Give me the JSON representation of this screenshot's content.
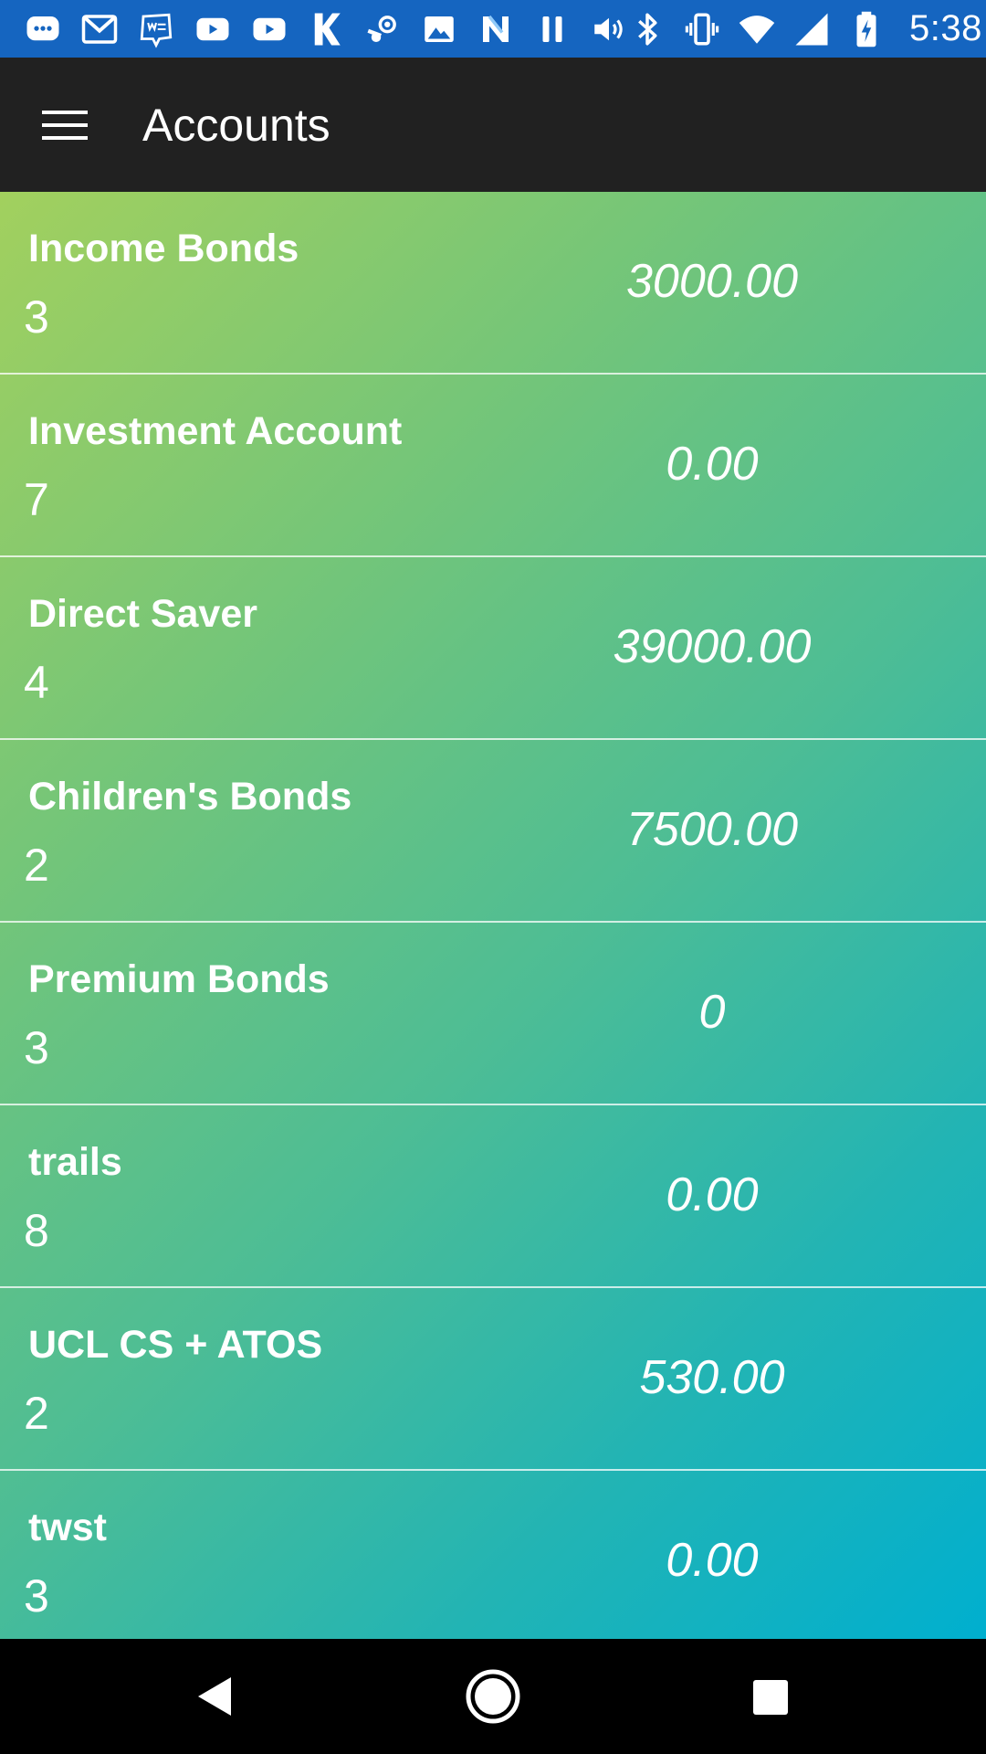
{
  "status_bar": {
    "time": "5:38",
    "bg_color": "#1565c0",
    "left_icons": [
      "message-icon",
      "gmail-icon",
      "webtoon-icon",
      "youtube-icon",
      "youtube-icon",
      "k-app-icon",
      "steam-icon",
      "image-icon",
      "n-app-icon",
      "pause-icon",
      "volume-icon"
    ],
    "right_icons": [
      "bluetooth-icon",
      "vibrate-icon",
      "wifi-icon",
      "signal-icon",
      "battery-charging-icon"
    ]
  },
  "toolbar": {
    "title": "Accounts",
    "menu_icon": "hamburger-menu-icon",
    "bg_color": "#212121"
  },
  "accounts": [
    {
      "name": "Income Bonds",
      "count": "3",
      "balance": "3000.00"
    },
    {
      "name": "Investment Account",
      "count": "7",
      "balance": "0.00"
    },
    {
      "name": "Direct Saver",
      "count": "4",
      "balance": "39000.00"
    },
    {
      "name": "Children's Bonds",
      "count": "2",
      "balance": "7500.00"
    },
    {
      "name": "Premium Bonds",
      "count": "3",
      "balance": "0"
    },
    {
      "name": "trails",
      "count": "8",
      "balance": "0.00"
    },
    {
      "name": "UCL CS + ATOS",
      "count": "2",
      "balance": "530.00"
    },
    {
      "name": "twst",
      "count": "3",
      "balance": "0.00"
    }
  ],
  "list_gradient": {
    "start_color": "#a2d05e",
    "end_color": "#00afcf"
  },
  "nav_bar": {
    "back_icon": "back-triangle-icon",
    "home_icon": "home-circle-icon",
    "recents_icon": "recents-square-icon"
  }
}
